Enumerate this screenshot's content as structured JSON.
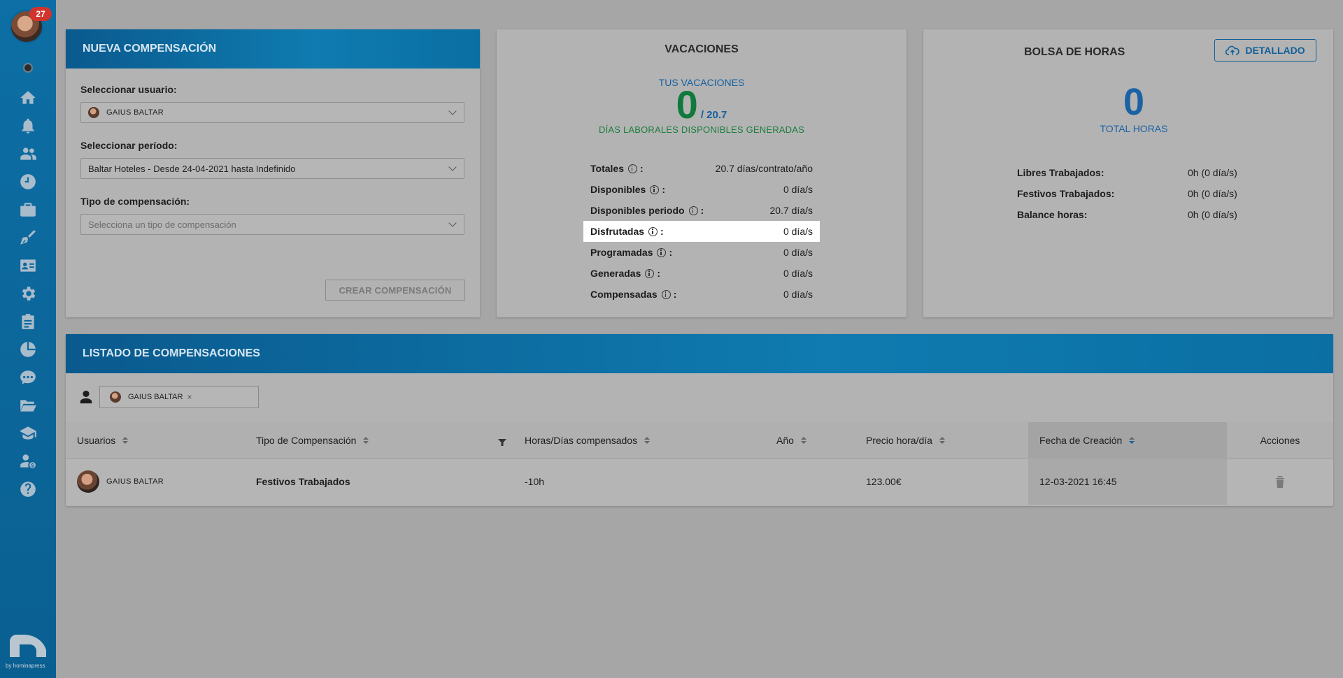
{
  "sidebar": {
    "notification_count": "27",
    "icons": [
      "home-icon",
      "bell-icon",
      "users-icon",
      "clock-icon",
      "briefcase-icon",
      "brush-icon",
      "id-card-icon",
      "gear-icon",
      "clipboard-icon",
      "pie-chart-icon",
      "chat-icon",
      "folder-icon",
      "graduation-cap-icon",
      "user-money-icon",
      "help-icon"
    ],
    "logo_text": "by hominapress"
  },
  "nueva": {
    "title": "NUEVA COMPENSACIÓN",
    "user_label": "Seleccionar usuario:",
    "user_value": "GAIUS BALTAR",
    "period_label": "Seleccionar período:",
    "period_value": "Baltar Hoteles - Desde 24-04-2021 hasta Indefinido",
    "type_label": "Tipo de compensación:",
    "type_placeholder": "Selecciona un tipo de compensación",
    "create_button": "CREAR COMPENSACIÓN"
  },
  "vacaciones": {
    "title": "VACACIONES",
    "subtitle": "TUS VACACIONES",
    "big_value": "0",
    "total": "/ 20.7",
    "generated_label": "DÍAS LABORALES DISPONIBLES GENERADAS",
    "rows": [
      {
        "label": "Totales",
        "value": "20.7 días/contrato/año"
      },
      {
        "label": "Disponibles",
        "value": "0 día/s"
      },
      {
        "label": "Disponibles periodo",
        "value": "20.7 día/s"
      },
      {
        "label": "Disfrutadas",
        "value": "0 día/s"
      },
      {
        "label": "Programadas",
        "value": "0 día/s"
      },
      {
        "label": "Generadas",
        "value": "0 día/s"
      },
      {
        "label": "Compensadas",
        "value": "0 día/s"
      }
    ]
  },
  "bolsa": {
    "title": "BOLSA DE HORAS",
    "detail_button": "DETALLADO",
    "big_value": "0",
    "subtitle": "TOTAL HORAS",
    "rows": [
      {
        "label": "Libres Trabajados:",
        "value": "0h (0 día/s)"
      },
      {
        "label": "Festivos Trabajados:",
        "value": "0h (0 día/s)"
      },
      {
        "label": "Balance horas:",
        "value": "0h (0 día/s)"
      }
    ]
  },
  "listado": {
    "title": "LISTADO DE COMPENSACIONES",
    "filter_chip": "GAIUS BALTAR",
    "columns": [
      "Usuarios",
      "Tipo de Compensación",
      "Horas/Días compensados",
      "Año",
      "Precio hora/día",
      "Fecha de Creación",
      "Acciones"
    ],
    "rows": [
      {
        "usuario": "GAIUS BALTAR",
        "tipo": "Festivos Trabajados",
        "horas": "-10h",
        "anio": "",
        "precio": "123.00€",
        "fecha": "12-03-2021 16:45"
      }
    ]
  }
}
